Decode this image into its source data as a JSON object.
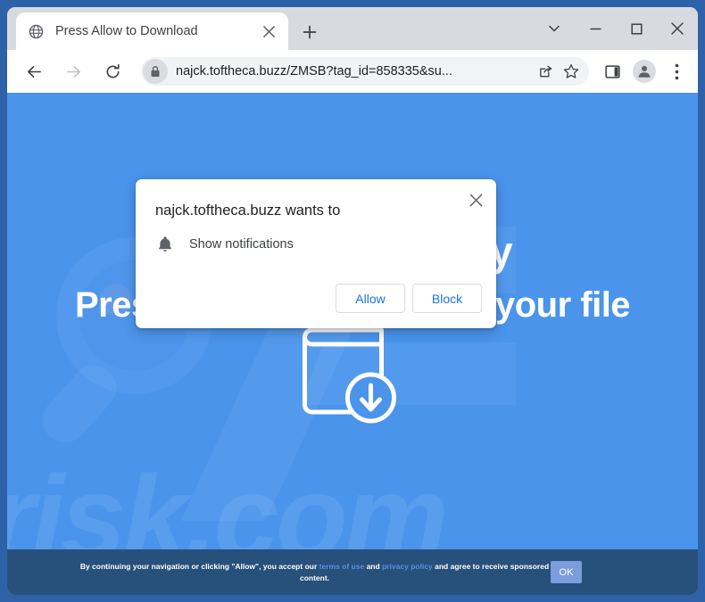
{
  "window": {
    "controls": {
      "tab_search_label": "Search tabs",
      "minimize_label": "Minimize",
      "maximize_label": "Maximize",
      "close_label": "Close"
    }
  },
  "tab": {
    "title": "Press Allow to Download",
    "favicon": "globe-icon",
    "close_label": "Close tab",
    "new_tab_label": "New tab"
  },
  "toolbar": {
    "back_label": "Back",
    "forward_label": "Forward",
    "reload_label": "Reload",
    "url": "najck.toftheca.buzz/ZMSB?tag_id=858335&su...",
    "lock_icon": "lock-icon",
    "share_label": "Share this page",
    "bookmark_label": "Bookmark this tab",
    "side_panel_label": "Side panel",
    "profile_label": "Profile",
    "menu_label": "Customize and control Google Chrome"
  },
  "page": {
    "headline_line1": "Your file is ready",
    "headline_line2": "Press Allow to download your file",
    "illustration": "document-download-icon",
    "watermark_text": "risk.com",
    "background_color": "#4a94ec"
  },
  "consent_banner": {
    "text_part1": "By continuing your navigation or clicking \"Allow\", you accept our",
    "link_terms": "terms of use",
    "text_and": "and",
    "link_privacy": "privacy policy",
    "text_part2": "and agree to receive sponsored content.",
    "ok_label": "OK",
    "background_color": "#27507a",
    "ok_color": "#7b9ddb"
  },
  "permission_dialog": {
    "title": "najck.toftheca.buzz wants to",
    "permission_icon": "bell-icon",
    "permission_label": "Show notifications",
    "allow_label": "Allow",
    "block_label": "Block",
    "close_label": "Close",
    "accent_color": "#1a73e8"
  }
}
